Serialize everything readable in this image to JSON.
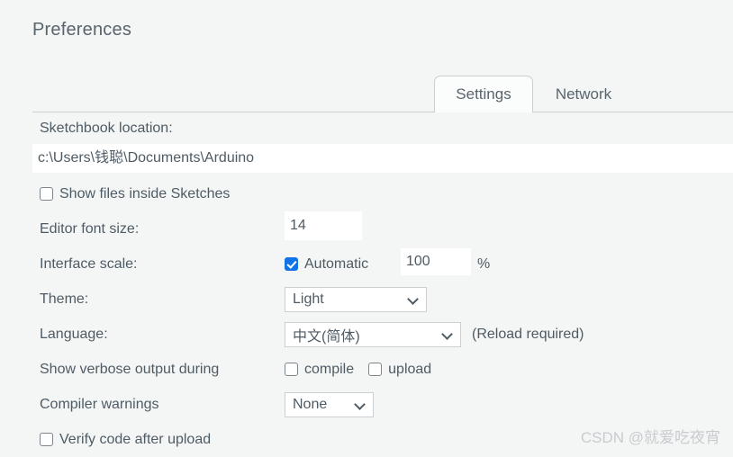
{
  "dialog": {
    "title": "Preferences"
  },
  "tabs": [
    {
      "label": "Settings",
      "active": true
    },
    {
      "label": "Network",
      "active": false
    }
  ],
  "settings": {
    "sketchbook": {
      "label": "Sketchbook location:",
      "value": "c:\\Users\\钱聪\\Documents\\Arduino"
    },
    "show_files_inside_sketches": {
      "label": "Show files inside Sketches",
      "checked": false
    },
    "editor_font_size": {
      "label": "Editor font size:",
      "value": "14"
    },
    "interface_scale": {
      "label": "Interface scale:",
      "automatic_label": "Automatic",
      "automatic_checked": true,
      "value": "100",
      "unit": "%"
    },
    "theme": {
      "label": "Theme:",
      "value": "Light"
    },
    "language": {
      "label": "Language:",
      "value": "中文(简体)",
      "note": "(Reload required)"
    },
    "verbose_output": {
      "label": "Show verbose output during",
      "compile_label": "compile",
      "compile_checked": false,
      "upload_label": "upload",
      "upload_checked": false
    },
    "compiler_warnings": {
      "label": "Compiler warnings",
      "value": "None"
    },
    "verify_code": {
      "label": "Verify code after upload",
      "checked": false
    }
  },
  "watermark": {
    "text": "CSDN @就爱吃夜宵"
  },
  "colors": {
    "accent": "#1273e6",
    "background": "#f4f6f6",
    "text": "#4f5b64",
    "border": "#c9cfd3"
  }
}
